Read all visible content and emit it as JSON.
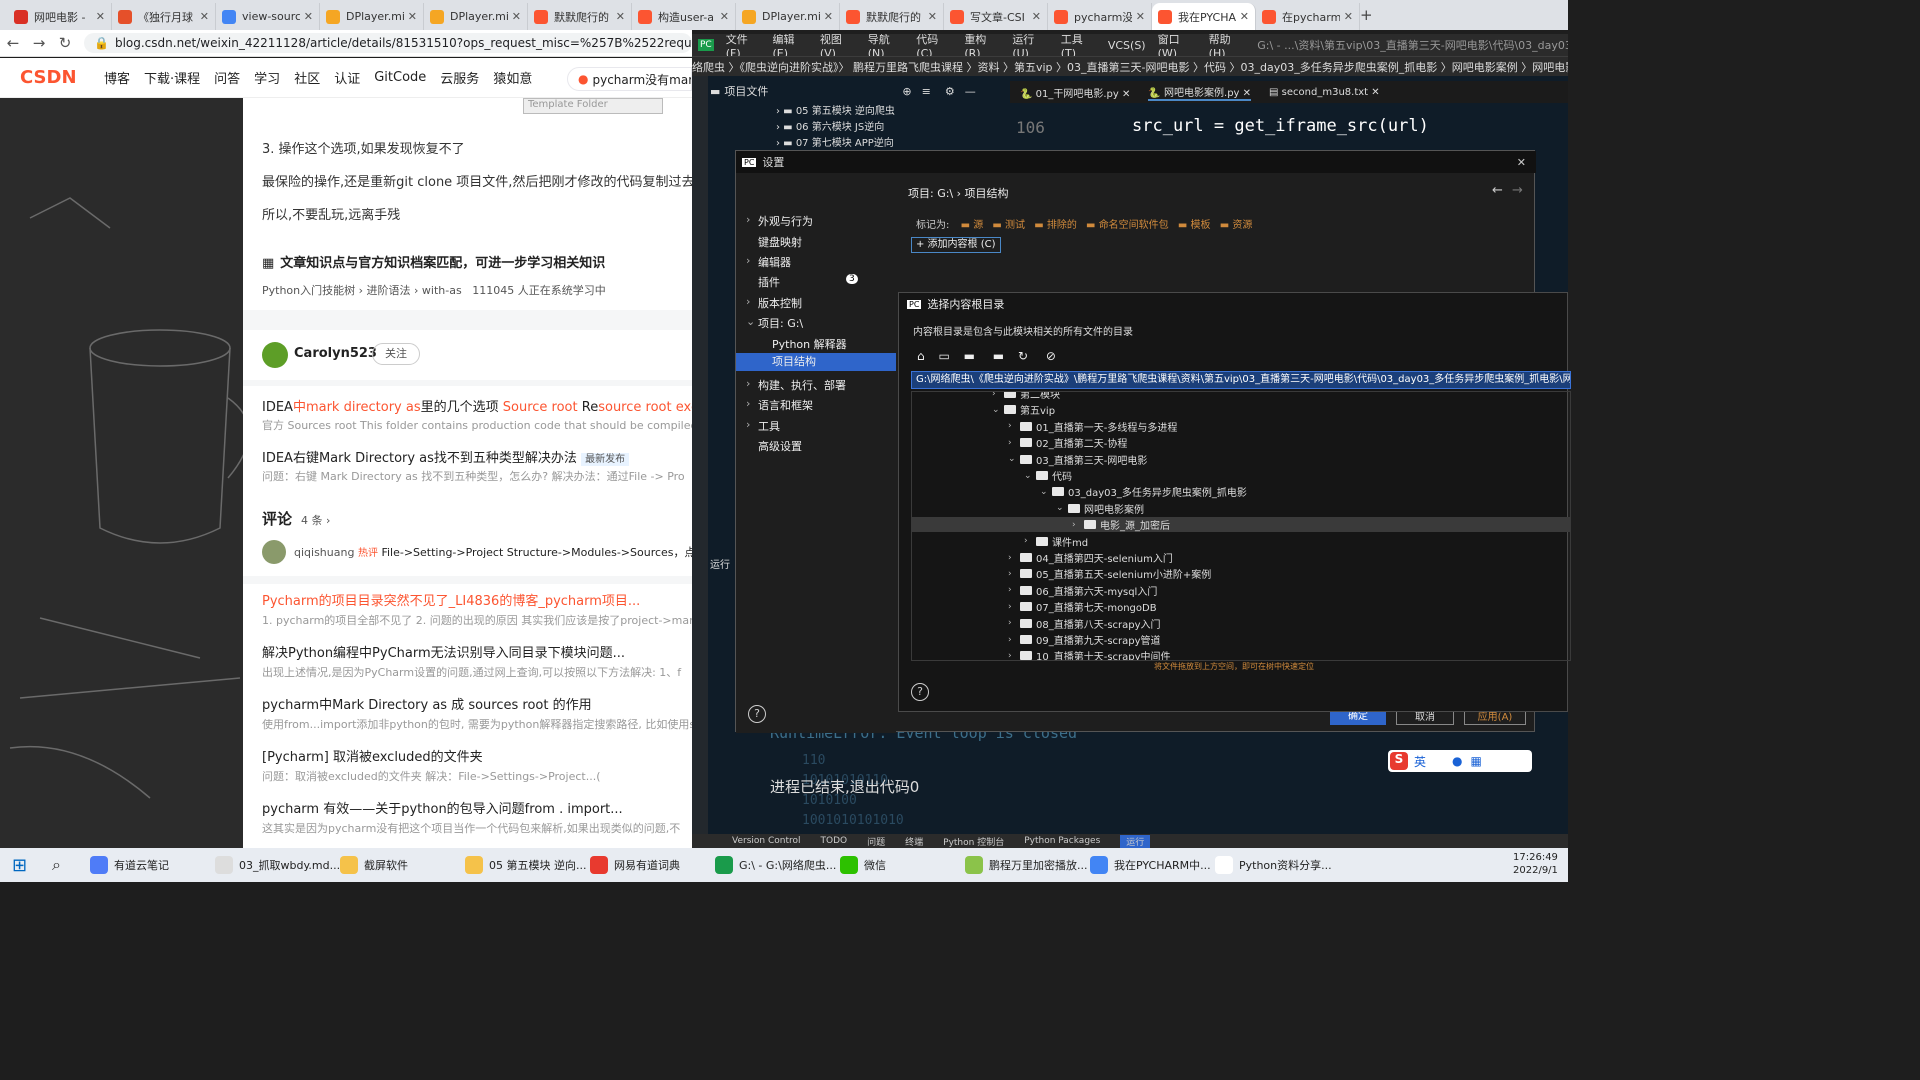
{
  "browser": {
    "tabs": [
      {
        "label": "网吧电影 -",
        "color": "#d93025"
      },
      {
        "label": "《独行月球",
        "color": "#e5502a"
      },
      {
        "label": "view-sourc",
        "color": "#4285f4"
      },
      {
        "label": "DPlayer.mi",
        "color": "#f5a623"
      },
      {
        "label": "DPlayer.mi",
        "color": "#f5a623"
      },
      {
        "label": "默默爬行的",
        "color": "#fc5531"
      },
      {
        "label": "构造user-a",
        "color": "#fc5531"
      },
      {
        "label": "DPlayer.mi",
        "color": "#f5a623"
      },
      {
        "label": "默默爬行的",
        "color": "#fc5531"
      },
      {
        "label": "写文章-CSI",
        "color": "#fc5531"
      },
      {
        "label": "pycharm没",
        "color": "#fc5531"
      },
      {
        "label": "我在PYCHA",
        "color": "#fc5531"
      },
      {
        "label": "在pycharm",
        "color": "#fc5531"
      }
    ],
    "new_tab": "+",
    "url": "blog.csdn.net/weixin_42211128/article/details/81531510?ops_request_misc=%257B%2522request%255Fi"
  },
  "csdn": {
    "logo": "CSDN",
    "nav": [
      "博客",
      "下载·课程",
      "问答",
      "学习",
      "社区",
      "认证",
      "GitCode",
      "云服务",
      "猿如意"
    ],
    "search": "pycharm没有mark"
  },
  "article": {
    "template_folder": "Template Folder",
    "p1": "3. 操作这个选项,如果发现恢复不了",
    "p2": "最保险的操作,还是重新git clone 项目文件,然后把刚才修改的代码复制过去",
    "p3": "所以,不要乱玩,远离手残",
    "kb_title": "文章知识点与官方知识档案匹配，可进一步学习相关知识",
    "kb_path": "Python入门技能树 › 进阶语法 › with-as",
    "kb_count": "111045 人正在系统学习中",
    "author": "Carolyn523",
    "follow": "关注",
    "related": [
      {
        "title_parts": [
          "IDEA",
          "中mark directory as",
          "里的几个选项 ",
          "Source root",
          " Re",
          "source root exclude"
        ],
        "desc": "官方 Sources root This folder contains production code that should be compiled. Gen"
      },
      {
        "title": "IDEA右键Mark Directory as找不到五种类型解决办法",
        "badge": "最新发布",
        "desc": "问题：右键 Mark Directory as 找不到五种类型，怎么办? 解决办法：通过File -> Pro"
      }
    ],
    "comments_title": "评论",
    "comments_count": "4 条",
    "comment_user": "qiqishuang",
    "comment_badge": "热评",
    "comment_text": "File->Setting->Project Structure->Modules->Sources，点击",
    "more": [
      {
        "title": "Pycharm的项目目录突然不见了_LI4836的博客_pycharm项目...",
        "desc": "1. pycharm的项目全部不见了 2. 问题的出现的原因 其实我们应该是按了project->mark"
      },
      {
        "title": "解决Python编程中PyCharm无法识别导入同目录下模块问题...",
        "desc": "出现上述情况,是因为PyCharm设置的问题,通过网上查询,可以按照以下方法解决: 1、f"
      },
      {
        "title": "pycharm中Mark Directory as 成 sources root 的作用",
        "desc": "使用from...import添加非python的包时, 需要为python解释器指定搜索路径, 比如使用s"
      },
      {
        "title": "[Pycharm] 取消被excluded的文件夹",
        "desc": "问题：取消被excluded的文件夹 解决：File->Settings->Project...("
      },
      {
        "title": "pycharm 有效——关于python的包导入问题from . import...",
        "desc": "这其实是因为pycharm没有把这个项目当作一个代码包来解析,如果出现类似的问题,不"
      }
    ]
  },
  "ide": {
    "menu": [
      "文件(F)",
      "编辑(E)",
      "视图(V)",
      "导航(N)",
      "代码(C)",
      "重构(R)",
      "运行(U)",
      "工具(T)",
      "VCS(S)",
      "窗口(W)",
      "帮助(H)"
    ],
    "title_path": "G:\\ - ...\\资料\\第五vip\\03_直播第三天-网吧电影\\代码\\03_day03_多任务异步爬...",
    "breadcrumb": "络爬虫 〉《爬虫逆向进阶实战》〉 鹏程万里路飞爬虫课程 〉资料 〉第五vip 〉03_直播第三天-网吧电影 〉代码 〉03_day03_多任务异步爬虫案例_抓电影 〉网吧电影案例 〉网吧电影案例.py",
    "project_label": "项目文件",
    "project_items": [
      "05 第五模块 逆向爬虫",
      "06 第六模块 JS逆向",
      "07 第七模块 APP逆向"
    ],
    "editor_tabs": [
      "01_干网吧电影.py",
      "网吧电影案例.py",
      "second_m3u8.txt"
    ],
    "line_no": "106",
    "code_line": "src_url = get_iframe_src(url)",
    "run_label": "运行",
    "console_error": "RuntimeError: Event loop is closed",
    "console_exit": "进程已结束,退出代码0",
    "bottom_tabs": [
      "Version Control",
      "TODO",
      "问题",
      "终端",
      "Python 控制台",
      "Python Packages",
      "运行"
    ]
  },
  "settings": {
    "title": "设置",
    "search_placeholder": "",
    "nav": [
      "外观与行为",
      "键盘映射",
      "编辑器",
      "插件",
      "版本控制",
      "项目: G:\\",
      "Python 解释器",
      "项目结构",
      "构建、执行、部署",
      "语言和框架",
      "工具",
      "高级设置"
    ],
    "plugin_badge": "3",
    "crumb": "项目: G:\\  ›  项目结构",
    "mark_as": "标记为:",
    "marks": [
      "源",
      "测试",
      "排除的",
      "命名空间软件包",
      "模板",
      "资源"
    ],
    "add_root": "+ 添加内容根 (C)",
    "ok": "确定",
    "cancel": "取消",
    "apply": "应用(A)"
  },
  "chooser": {
    "title": "选择内容根目录",
    "desc": "内容根目录是包含与此模块相关的所有文件的目录",
    "path": "G:\\网络爬虫\\《爬虫逆向进阶实战》\\鹏程万里路飞爬虫课程\\资料\\第五vip\\03_直播第三天-网吧电影\\代码\\03_day03_多任务异步爬虫案例_抓电影\\网吧电影",
    "tree": [
      {
        "label": "第二模块",
        "indent": 0,
        "arrow": "›"
      },
      {
        "label": "第五vip",
        "indent": 0,
        "arrow": "⌄"
      },
      {
        "label": "01_直播第一天-多线程与多进程",
        "indent": 1,
        "arrow": "›"
      },
      {
        "label": "02_直播第二天-协程",
        "indent": 1,
        "arrow": "›"
      },
      {
        "label": "03_直播第三天-网吧电影",
        "indent": 1,
        "arrow": "⌄"
      },
      {
        "label": "代码",
        "indent": 2,
        "arrow": "⌄"
      },
      {
        "label": "03_day03_多任务异步爬虫案例_抓电影",
        "indent": 3,
        "arrow": "⌄"
      },
      {
        "label": "网吧电影案例",
        "indent": 4,
        "arrow": "⌄"
      },
      {
        "label": "电影_源_加密后",
        "indent": 5,
        "arrow": "›"
      },
      {
        "label": "课件md",
        "indent": 2,
        "arrow": "›"
      },
      {
        "label": "04_直播第四天-selenium入门",
        "indent": 1,
        "arrow": "›"
      },
      {
        "label": "05_直播第五天-selenium小进阶+案例",
        "indent": 1,
        "arrow": "›"
      },
      {
        "label": "06_直播第六天-mysql入门",
        "indent": 1,
        "arrow": "›"
      },
      {
        "label": "07_直播第七天-mongoDB",
        "indent": 1,
        "arrow": "›"
      },
      {
        "label": "08_直播第八天-scrapy入门",
        "indent": 1,
        "arrow": "›"
      },
      {
        "label": "09_直播第九天-scrapy管道",
        "indent": 1,
        "arrow": "›"
      },
      {
        "label": "10_直播第十天-scrapy中间件",
        "indent": 1,
        "arrow": "›"
      }
    ],
    "hint": "将文件拖放到上方空间，即可在树中快速定位"
  },
  "taskbar": {
    "items": [
      "有道云笔记",
      "03_抓取wbdy.md...",
      "截屏软件",
      "05 第五模块 逆向...",
      "网易有道词典",
      "G:\\ - G:\\网络爬虫...",
      "微信",
      "鹏程万里加密播放...",
      "我在PYCHARM中...",
      "Python资料分享..."
    ],
    "time": "17:26:49",
    "date": "2022/9/1",
    "ime": "英"
  }
}
